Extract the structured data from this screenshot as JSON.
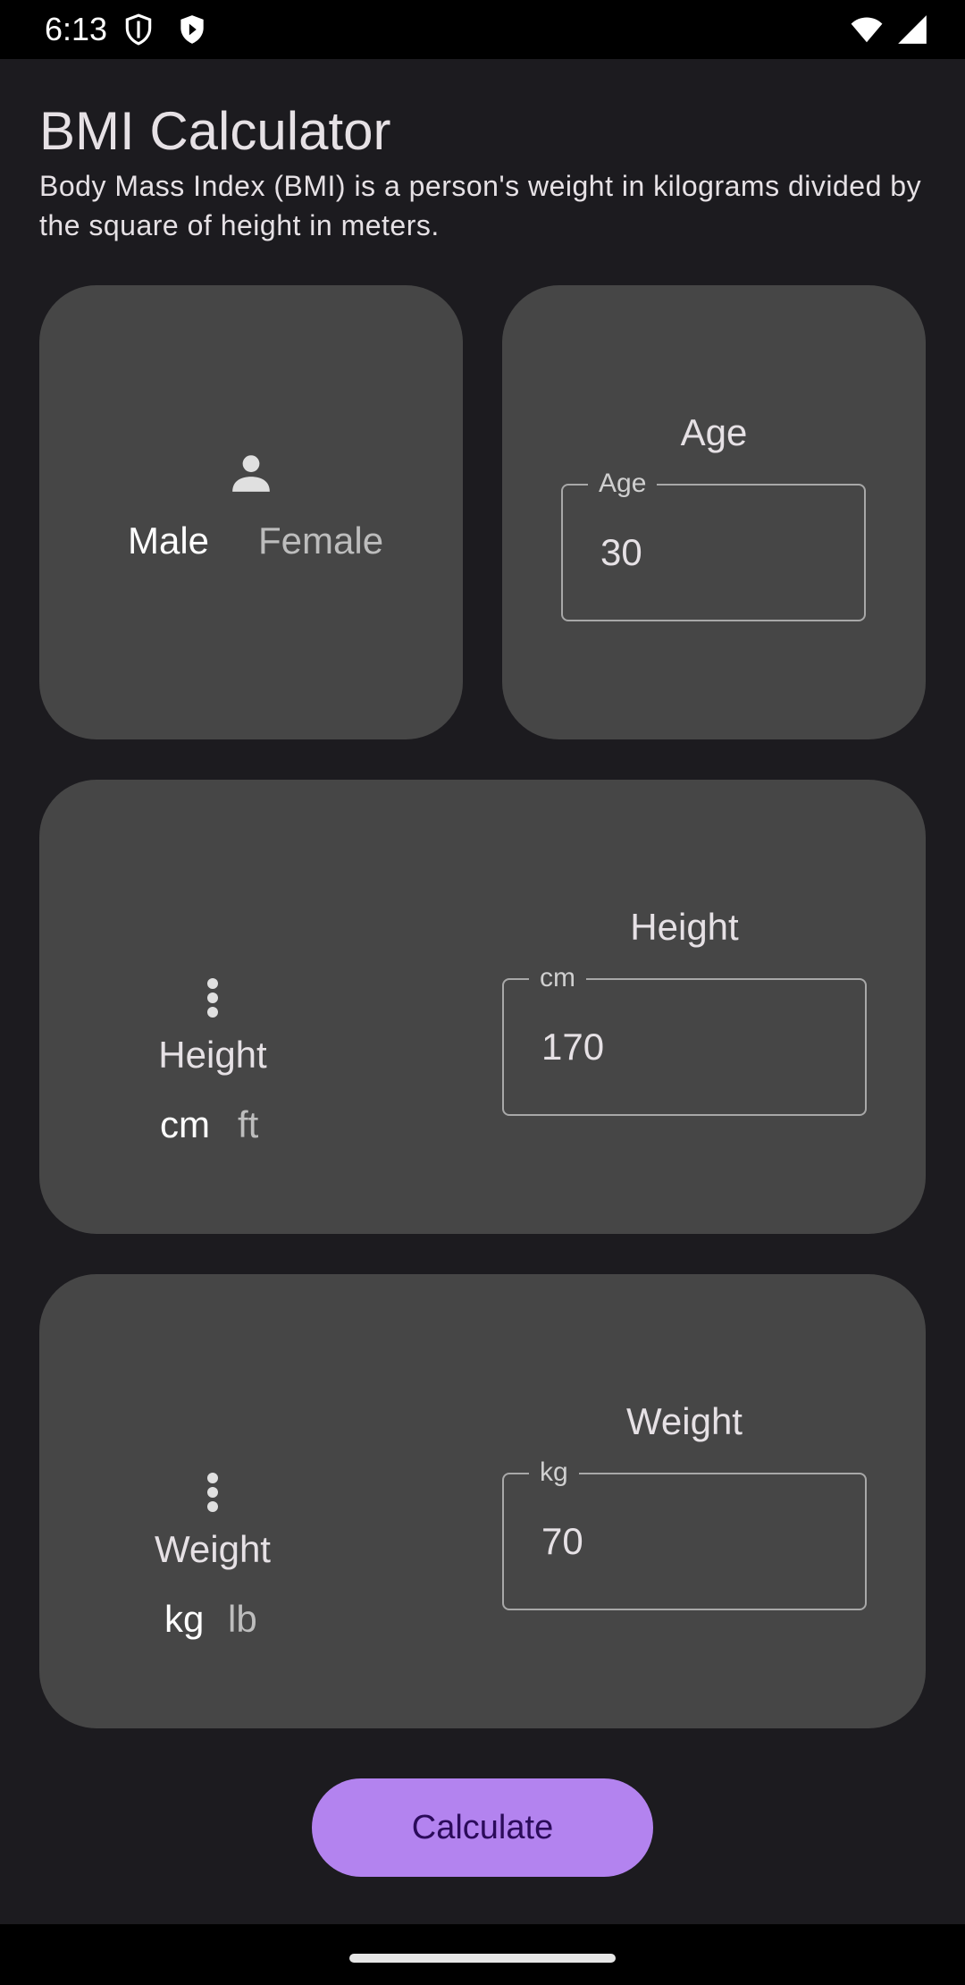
{
  "status_bar": {
    "time": "6:13",
    "icons": [
      "shield-icon",
      "play-protect-icon",
      "wifi-icon",
      "signal-icon"
    ]
  },
  "header": {
    "title": "BMI Calculator",
    "description": "Body Mass Index (BMI) is a person's weight in kilograms divided by the square of height in meters."
  },
  "gender": {
    "icon": "person-icon",
    "options": [
      "Male",
      "Female"
    ],
    "selected": "Male"
  },
  "age": {
    "heading": "Age",
    "field_label": "Age",
    "value": "30"
  },
  "height": {
    "icon": "more-vert-icon",
    "label": "Height",
    "units": [
      "cm",
      "ft"
    ],
    "selected_unit": "cm",
    "heading": "Height",
    "field_label": "cm",
    "value": "170"
  },
  "weight": {
    "icon": "more-vert-icon",
    "label": "Weight",
    "units": [
      "kg",
      "lb"
    ],
    "selected_unit": "kg",
    "heading": "Weight",
    "field_label": "kg",
    "value": "70"
  },
  "actions": {
    "calculate_label": "Calculate"
  },
  "colors": {
    "background": "#1c1b1f",
    "card": "#464646",
    "accent": "#b383ef",
    "on_accent": "#2b0b5a"
  }
}
